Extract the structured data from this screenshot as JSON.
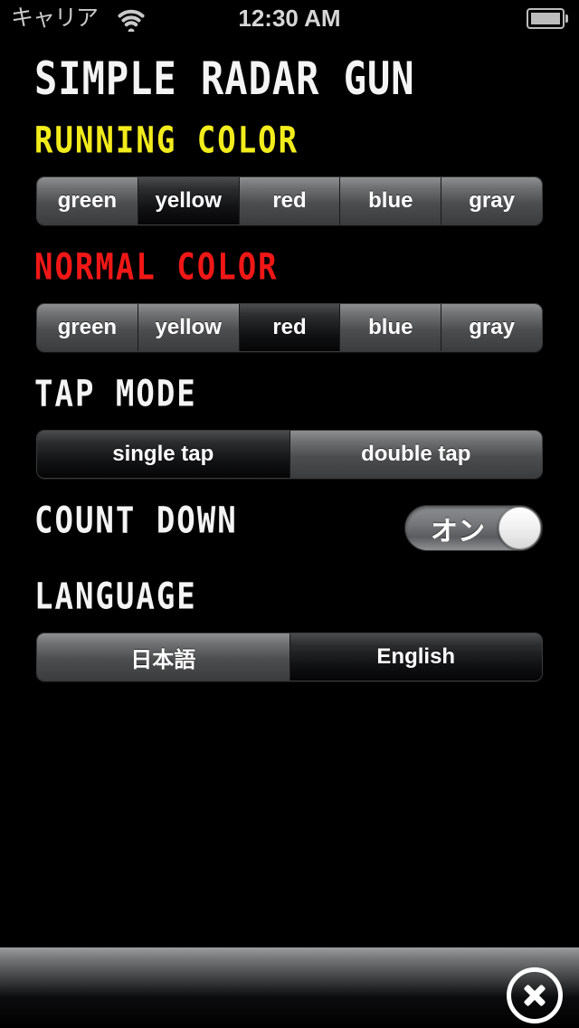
{
  "status_bar": {
    "carrier": "キャリア",
    "wifi_icon": "wifi-icon",
    "time": "12:30 AM",
    "battery_icon": "battery-icon"
  },
  "app": {
    "title": "SIMPLE RADAR GUN"
  },
  "sections": {
    "running_color": {
      "heading": "RUNNING COLOR",
      "heading_color": "#f2ec1c",
      "options": [
        "green",
        "yellow",
        "red",
        "blue",
        "gray"
      ],
      "selected": "yellow"
    },
    "normal_color": {
      "heading": "NORMAL COLOR",
      "heading_color": "#f01717",
      "options": [
        "green",
        "yellow",
        "red",
        "blue",
        "gray"
      ],
      "selected": "red"
    },
    "tap_mode": {
      "heading": "TAP MODE",
      "heading_color": "#f4f4f4",
      "options": [
        "single tap",
        "double tap"
      ],
      "selected": "single tap"
    },
    "count_down": {
      "heading": "COUNT DOWN",
      "heading_color": "#f4f4f4",
      "toggle_label": "オン",
      "toggle_state": "on"
    },
    "language": {
      "heading": "LANGUAGE",
      "heading_color": "#f4f4f4",
      "options": [
        "日本語",
        "English"
      ],
      "selected": "English"
    }
  },
  "bottom_bar": {
    "close_icon": "close-icon"
  }
}
